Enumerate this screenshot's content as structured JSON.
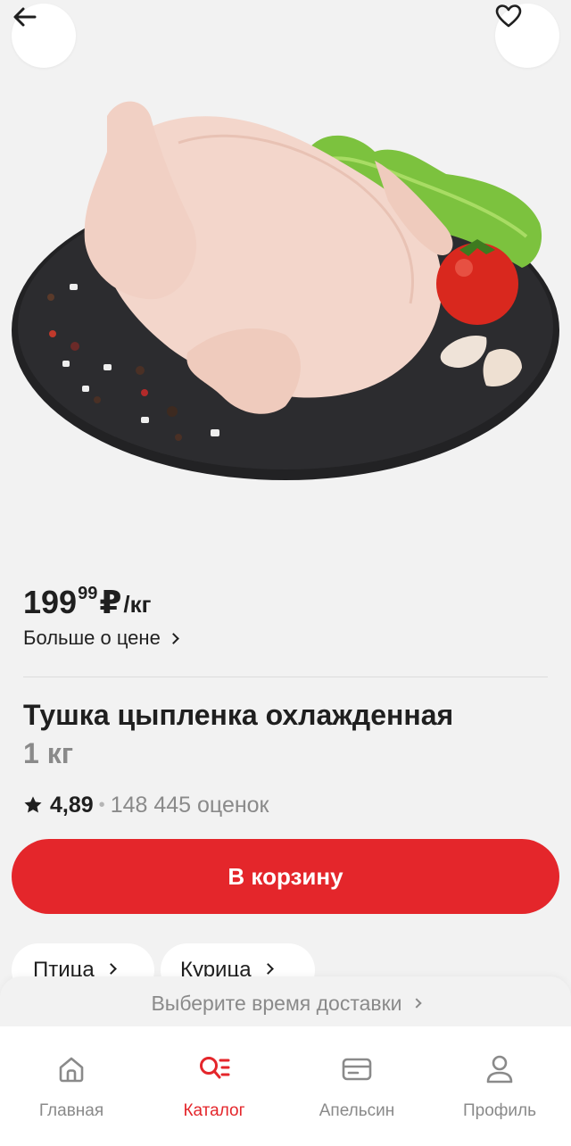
{
  "header": {
    "back_icon": "arrow-left-icon",
    "favorite_icon": "heart-icon"
  },
  "product": {
    "image": "chicken-carcass-on-slate-photo",
    "price_main": "199",
    "price_cents": "99",
    "currency": "₽",
    "unit": "/кг",
    "more_price_label": "Больше о цене",
    "title": "Тушка цыпленка охлажденная",
    "weight": "1 кг",
    "rating_value": "4,89",
    "rating_count": "148 445 оценок",
    "add_to_cart_label": "В корзину"
  },
  "categories": [
    {
      "label": "Птица"
    },
    {
      "label": "Курица"
    }
  ],
  "delivery": {
    "label": "Выберите время доставки"
  },
  "nav": {
    "items": [
      {
        "label": "Главная",
        "icon": "home-icon",
        "active": false
      },
      {
        "label": "Каталог",
        "icon": "catalog-search-icon",
        "active": true
      },
      {
        "label": "Апельсин",
        "icon": "card-icon",
        "active": false
      },
      {
        "label": "Профиль",
        "icon": "profile-icon",
        "active": false
      }
    ]
  },
  "colors": {
    "accent": "#e4262b",
    "background": "#f2f2f2",
    "text": "#1f1f1f",
    "muted": "#8a8a8a"
  }
}
